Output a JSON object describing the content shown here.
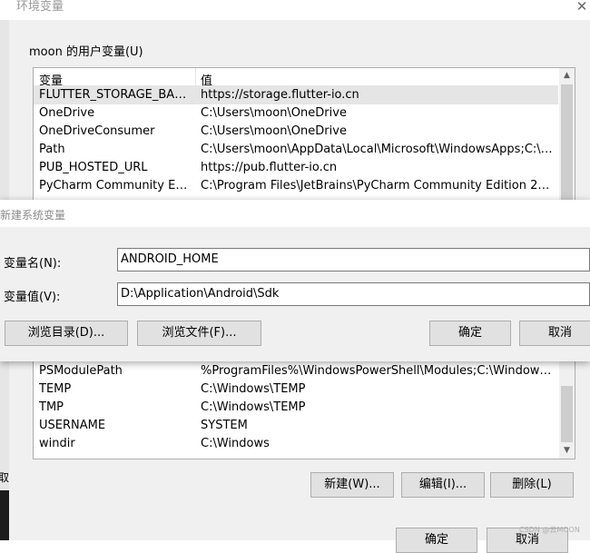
{
  "env_window": {
    "title": "环境变量",
    "close_glyph": "✕",
    "left_strip_text": "取",
    "user_vars": {
      "group_label": "moon 的用户变量(U)",
      "columns": [
        "变量",
        "值"
      ],
      "rows": [
        {
          "name": "FLUTTER_STORAGE_BASE_...",
          "value": "https://storage.flutter-io.cn"
        },
        {
          "name": "OneDrive",
          "value": "C:\\Users\\moon\\OneDrive"
        },
        {
          "name": "OneDriveConsumer",
          "value": "C:\\Users\\moon\\OneDrive"
        },
        {
          "name": "Path",
          "value": "C:\\Users\\moon\\AppData\\Local\\Microsoft\\WindowsApps;C:\\Pro..."
        },
        {
          "name": "PUB_HOSTED_URL",
          "value": "https://pub.flutter-io.cn"
        },
        {
          "name": "PyCharm Community Edition",
          "value": "C:\\Program Files\\JetBrains\\PyCharm Community Edition 2021.1...."
        }
      ]
    },
    "system_vars": {
      "rows": [
        {
          "name": "PSModulePath",
          "value": "%ProgramFiles%\\WindowsPowerShell\\Modules;C:\\Windows\\sy..."
        },
        {
          "name": "TEMP",
          "value": "C:\\Windows\\TEMP"
        },
        {
          "name": "TMP",
          "value": "C:\\Windows\\TEMP"
        },
        {
          "name": "USERNAME",
          "value": "SYSTEM"
        },
        {
          "name": "windir",
          "value": "C:\\Windows"
        }
      ],
      "buttons": {
        "new": "新建(W)...",
        "edit": "编辑(I)...",
        "delete": "删除(L)"
      }
    },
    "buttons": {
      "ok": "确定",
      "cancel": "取消"
    },
    "watermark": "CSDN @云MOON"
  },
  "new_var_dialog": {
    "title": "新建系统变量",
    "name_label": "变量名(N):",
    "name_value": "ANDROID_HOME",
    "value_label": "变量值(V):",
    "value_value": "D:\\Application\\Android\\Sdk",
    "buttons": {
      "browse_dir": "浏览目录(D)...",
      "browse_file": "浏览文件(F)...",
      "ok": "确定",
      "cancel": "取消"
    }
  },
  "scroll_glyphs": {
    "up": "▲",
    "down": "▼"
  }
}
